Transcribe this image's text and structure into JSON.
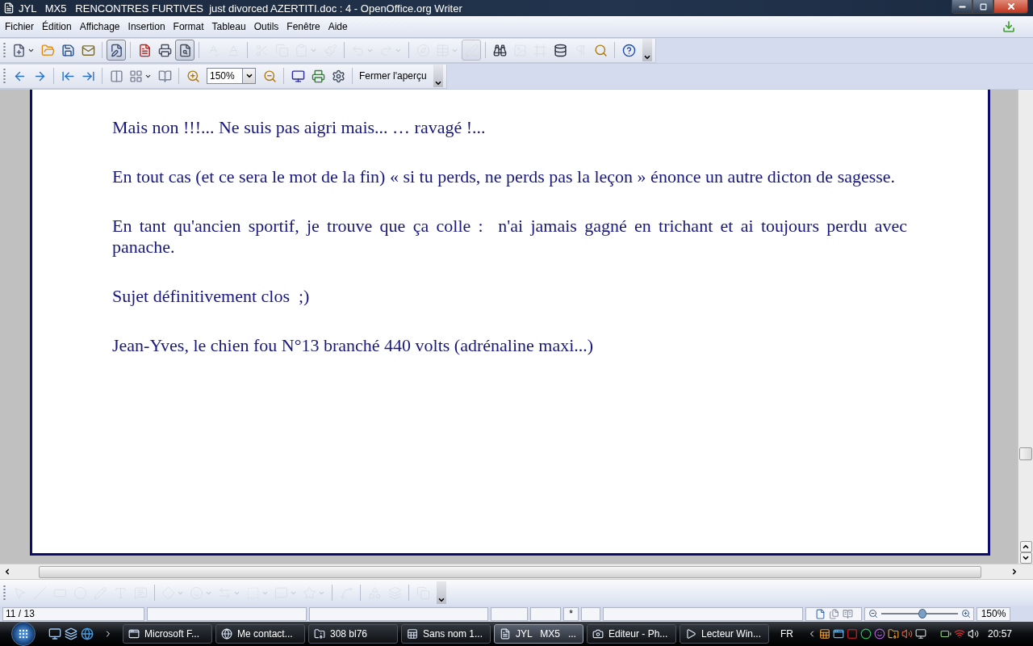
{
  "window": {
    "title": "JYL   MX5   RENCONTRES FURTIVES  just divorced AZERTITI.doc : 4 - OpenOffice.org Writer"
  },
  "menu": [
    {
      "label": "Fichier"
    },
    {
      "label": "Édition"
    },
    {
      "label": "Affichage"
    },
    {
      "label": "Insertion"
    },
    {
      "label": "Format"
    },
    {
      "label": "Tableau"
    },
    {
      "label": "Outils"
    },
    {
      "label": "Fenêtre"
    },
    {
      "label": "Aide"
    }
  ],
  "standard_toolbar": [
    {
      "kind": "new",
      "disabled": false,
      "pressed": false
    },
    {
      "kind": "open",
      "disabled": false,
      "pressed": false
    },
    {
      "kind": "save",
      "disabled": false,
      "pressed": false
    },
    {
      "kind": "mail",
      "disabled": false,
      "pressed": false
    },
    {
      "kind": "sep"
    },
    {
      "kind": "edit",
      "disabled": false,
      "pressed": true
    },
    {
      "kind": "sep"
    },
    {
      "kind": "pdf",
      "disabled": false,
      "pressed": false
    },
    {
      "kind": "print",
      "disabled": false,
      "pressed": false
    },
    {
      "kind": "preview",
      "disabled": false,
      "pressed": true
    },
    {
      "kind": "sep"
    },
    {
      "kind": "spell",
      "disabled": true,
      "pressed": false
    },
    {
      "kind": "autospell",
      "disabled": true,
      "pressed": false
    },
    {
      "kind": "sep"
    },
    {
      "kind": "cut",
      "disabled": true,
      "pressed": false
    },
    {
      "kind": "copy",
      "disabled": true,
      "pressed": false
    },
    {
      "kind": "paste",
      "disabled": true,
      "pressed": false
    },
    {
      "kind": "brush",
      "disabled": true,
      "pressed": false
    },
    {
      "kind": "sep"
    },
    {
      "kind": "undo",
      "disabled": true,
      "pressed": false
    },
    {
      "kind": "redo",
      "disabled": true,
      "pressed": false
    },
    {
      "kind": "sep"
    },
    {
      "kind": "navigator",
      "disabled": true,
      "pressed": false
    },
    {
      "kind": "table",
      "disabled": true,
      "pressed": false
    },
    {
      "kind": "draw",
      "disabled": true,
      "pressed": true
    },
    {
      "kind": "sep"
    },
    {
      "kind": "find",
      "disabled": false,
      "pressed": false
    },
    {
      "kind": "gallery",
      "disabled": true,
      "pressed": false
    },
    {
      "kind": "frame",
      "disabled": true,
      "pressed": false
    },
    {
      "kind": "database",
      "disabled": false,
      "pressed": false
    },
    {
      "kind": "pilcrow",
      "disabled": true,
      "pressed": false
    },
    {
      "kind": "zoom",
      "disabled": false,
      "pressed": false
    },
    {
      "kind": "sep"
    },
    {
      "kind": "help",
      "disabled": false,
      "pressed": false
    }
  ],
  "preview_toolbar": [
    {
      "kind": "prev"
    },
    {
      "kind": "next"
    },
    {
      "kind": "sep"
    },
    {
      "kind": "first"
    },
    {
      "kind": "last"
    },
    {
      "kind": "sep"
    },
    {
      "kind": "twopages"
    },
    {
      "kind": "multipages"
    },
    {
      "kind": "book"
    },
    {
      "kind": "sep"
    },
    {
      "kind": "zoomin"
    },
    {
      "kind": "zoom-field",
      "value": "150%"
    },
    {
      "kind": "zoomout"
    },
    {
      "kind": "sep"
    },
    {
      "kind": "fullscreen"
    },
    {
      "kind": "printpreview"
    },
    {
      "kind": "printoptions"
    },
    {
      "kind": "sep"
    },
    {
      "kind": "text-button",
      "label": "Fermer l'aperçu"
    }
  ],
  "document": {
    "paragraphs": [
      "Mais non !!!... Ne suis pas aigri mais... … ravagé !...",
      "En tout cas (et ce sera le mot de la fin) « si tu perds, ne perds pas la leçon » énonce un autre dicton de sagesse.",
      "En tant qu'ancien sportif, je trouve que ça colle :  n'ai jamais gagné en trichant et ai toujours perdu avec panache.",
      "Sujet définitivement clos  ;)",
      "Jean-Yves, le chien fou N°13 branché 440 volts (adrénaline maxi...)"
    ]
  },
  "drawing_toolbar": [
    {
      "kind": "select",
      "disabled": true
    },
    {
      "kind": "line",
      "disabled": true
    },
    {
      "kind": "rect",
      "disabled": true
    },
    {
      "kind": "ellipse",
      "disabled": true
    },
    {
      "kind": "pencil",
      "disabled": true
    },
    {
      "kind": "text",
      "disabled": true
    },
    {
      "kind": "callout",
      "disabled": true
    },
    {
      "kind": "sep"
    },
    {
      "kind": "diamond",
      "disabled": true
    },
    {
      "kind": "smiley",
      "disabled": true
    },
    {
      "kind": "arrows",
      "disabled": true
    },
    {
      "kind": "flowchart",
      "disabled": true
    },
    {
      "kind": "speech",
      "disabled": true
    },
    {
      "kind": "star",
      "disabled": true
    },
    {
      "kind": "sep"
    },
    {
      "kind": "points",
      "disabled": true
    },
    {
      "kind": "sep"
    },
    {
      "kind": "fontwork",
      "disabled": true
    },
    {
      "kind": "extrusion",
      "disabled": true
    },
    {
      "kind": "sep"
    },
    {
      "kind": "arrange",
      "disabled": true
    }
  ],
  "status_bar": {
    "page": "11 / 13",
    "modified": "*",
    "zoom_slider": {
      "level": 0.53
    },
    "zoom": "150%"
  },
  "taskbar": {
    "tasks": [
      {
        "label": "Microsoft F...",
        "kind": "app",
        "selected": false
      },
      {
        "label": "Me contact...",
        "kind": "browser",
        "selected": false
      },
      {
        "label": "308 bl76",
        "kind": "zip",
        "selected": false
      },
      {
        "label": "Sans nom 1...",
        "kind": "calc",
        "selected": false
      },
      {
        "label": "JYL   MX5   ...",
        "kind": "writer",
        "selected": true
      },
      {
        "label": "Editeur - Ph...",
        "kind": "camera",
        "selected": false
      },
      {
        "label": "Lecteur Win...",
        "kind": "player",
        "selected": false
      }
    ],
    "language": "FR",
    "clock": "20:57"
  }
}
